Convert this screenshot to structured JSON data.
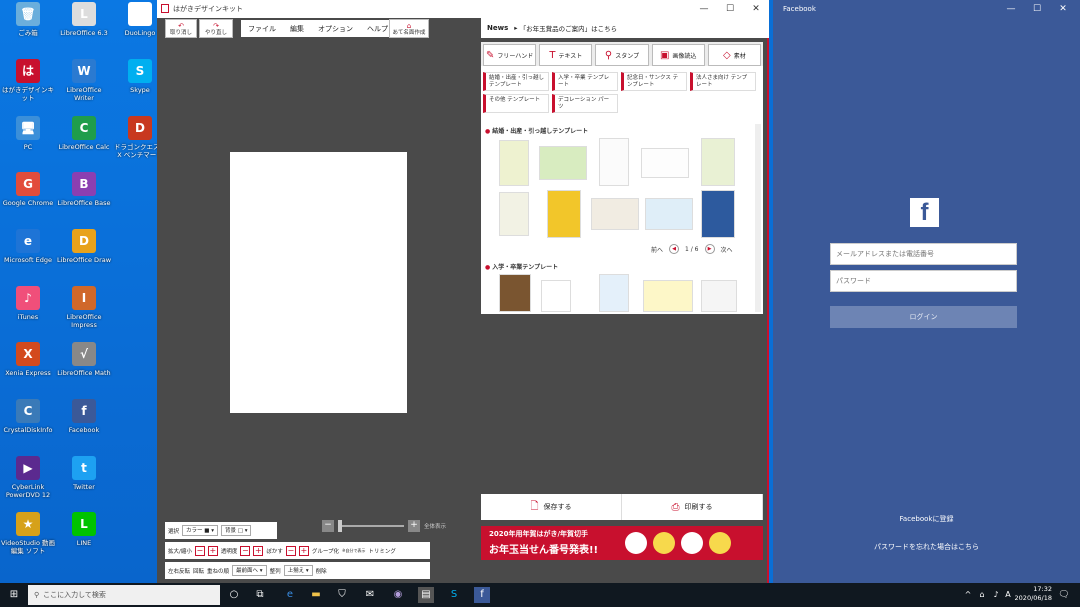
{
  "desktop": {
    "icons": [
      {
        "label": "ごみ箱",
        "glyph": "🗑",
        "color": "#6aaedc"
      },
      {
        "label": "LibreOffice 6.3",
        "glyph": "L",
        "color": "#ddd"
      },
      {
        "label": "DuoLingo",
        "glyph": "✎",
        "color": "#fff"
      },
      {
        "label": "はがきデザインキット",
        "glyph": "は",
        "color": "#c8102e"
      },
      {
        "label": "LibreOffice Writer",
        "glyph": "W",
        "color": "#2a7ad1"
      },
      {
        "label": "Skype",
        "glyph": "S",
        "color": "#00aff0"
      },
      {
        "label": "PC",
        "glyph": "🖥",
        "color": "#3b8fd9"
      },
      {
        "label": "LibreOffice Calc",
        "glyph": "C",
        "color": "#1f9d4b"
      },
      {
        "label": "ドラゴンクエストX ベンチマーク",
        "glyph": "D",
        "color": "#c8381f"
      },
      {
        "label": "Google Chrome",
        "glyph": "G",
        "color": "#e24c3b"
      },
      {
        "label": "LibreOffice Base",
        "glyph": "B",
        "color": "#8b3fb1"
      },
      {
        "label": "Microsoft Edge",
        "glyph": "e",
        "color": "#1e74d6"
      },
      {
        "label": "LibreOffice Draw",
        "glyph": "D",
        "color": "#e8a21b"
      },
      {
        "label": "iTunes",
        "glyph": "♪",
        "color": "#f04f7a"
      },
      {
        "label": "LibreOffice Impress",
        "glyph": "I",
        "color": "#d0682a"
      },
      {
        "label": "Xenia Express",
        "glyph": "X",
        "color": "#d34a1e"
      },
      {
        "label": "LibreOffice Math",
        "glyph": "√",
        "color": "#888"
      },
      {
        "label": "CrystalDiskInfo",
        "glyph": "C",
        "color": "#3a7ab8"
      },
      {
        "label": "Facebook",
        "glyph": "f",
        "color": "#3b5998"
      },
      {
        "label": "CyberLink PowerDVD 12",
        "glyph": "▶",
        "color": "#5b2a8f"
      },
      {
        "label": "Twitter",
        "glyph": "t",
        "color": "#1da1f2"
      },
      {
        "label": "VideoStudio 動画編集 ソフト",
        "glyph": "★",
        "color": "#d6a11a"
      },
      {
        "label": "LINE",
        "glyph": "L",
        "color": "#00c300"
      }
    ]
  },
  "hagaki": {
    "title": "はがきデザインキット",
    "toolbar": {
      "undo": "取り消し",
      "redo": "やり直し",
      "menus": [
        "ファイル",
        "編集",
        "オプション",
        "ヘルプ"
      ],
      "address": "あて名面作成"
    },
    "news": {
      "label": "News",
      "text": "「お年玉賞品のご案内」はこちら"
    },
    "tabs": [
      {
        "icon": "✎",
        "label": "フリーハンド"
      },
      {
        "icon": "T",
        "label": "テキスト"
      },
      {
        "icon": "⚲",
        "label": "スタンプ"
      },
      {
        "icon": "▣",
        "label": "画像読込"
      },
      {
        "icon": "◇",
        "label": "素材"
      }
    ],
    "categories": [
      "結婚・出産・引っ越し テンプレート",
      "入学・卒業 テンプレート",
      "記念日・サンクス テンプレート",
      "法人さま向け テンプレート",
      "その他 テンプレート",
      "デコレーション パーツ"
    ],
    "section1": "結婚・出産・引っ越しテンプレート",
    "section2": "入学・卒業テンプレート",
    "pager": {
      "prev": "前へ",
      "page": "1 / 6",
      "next": "次へ"
    },
    "save": "保存する",
    "print": "印刷する",
    "banner": {
      "line1": "2020年用年賀はがき/年賀切手",
      "line2": "お年玉当せん番号発表!!"
    },
    "zoom_label": "全体表示",
    "tools": {
      "select": "選択",
      "color": "カラー",
      "bg": "背景",
      "resize": "拡大/縮小",
      "opacity": "透明度",
      "blur": "ぼかす",
      "group": "グループ化",
      "group_hint": "※自分で表示",
      "trim": "トリミング",
      "flip": "左右反転",
      "rotate": "回転",
      "order": "重ねの順",
      "front": "最前面へ",
      "align": "整列",
      "top": "上揃え",
      "delete": "削除"
    }
  },
  "facebook": {
    "title": "Facebook",
    "email_placeholder": "メールアドレスまたは電話番号",
    "password_placeholder": "パスワード",
    "login": "ログイン",
    "register": "Facebookに登録",
    "forgot": "パスワードを忘れた場合はこちら"
  },
  "taskbar": {
    "search_placeholder": "ここに入力して検索",
    "time": "17:32",
    "date": "2020/06/18",
    "ime": "A"
  }
}
